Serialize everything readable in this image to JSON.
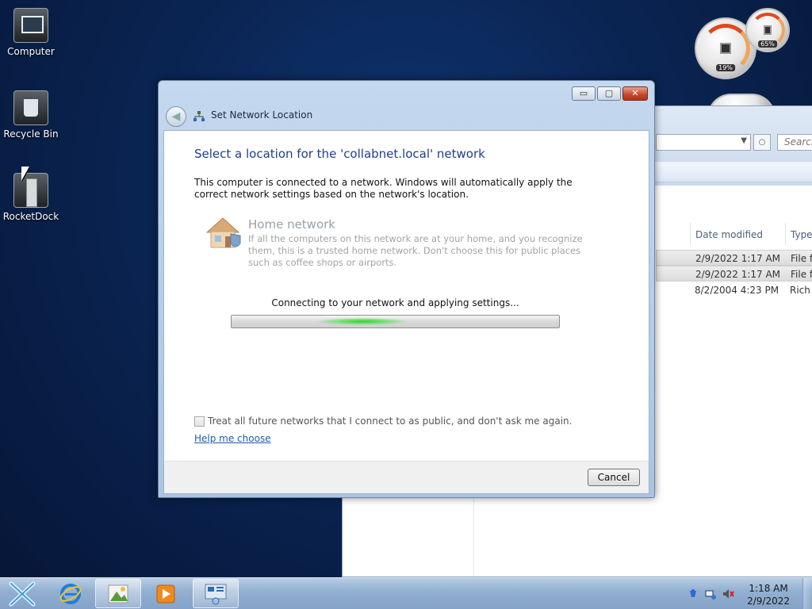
{
  "desktop": {
    "icons": [
      {
        "label": "Computer"
      },
      {
        "label": "Recycle Bin"
      },
      {
        "label": "RocketDock"
      }
    ]
  },
  "gadgets": {
    "cpu_percent": "19%",
    "memory_percent": "65%"
  },
  "explorer": {
    "search_placeholder": "Search",
    "columns": {
      "date": "Date modified",
      "type": "Type"
    },
    "rows": [
      {
        "date": "2/9/2022 1:17 AM",
        "type": "File fo",
        "selected": true
      },
      {
        "date": "2/9/2022 1:17 AM",
        "type": "File fo",
        "selected": true
      },
      {
        "date": "8/2/2004 4:23 PM",
        "type": "Rich T",
        "selected": false
      }
    ]
  },
  "dialog": {
    "title": "Set Network Location",
    "heading": "Select a location for the 'collabnet.local' network",
    "intro": "This computer is connected to a network. Windows will automatically apply the correct network settings based on the network's location.",
    "option": {
      "title": "Home network",
      "description": "If all the computers on this network are at your home, and you recognize them, this is a trusted home network.  Don't choose this for public places such as coffee shops or airports."
    },
    "status": "Connecting to your network and applying settings...",
    "progress_state": "indeterminate",
    "checkbox_label": "Treat all future networks that I connect to as public, and don't ask me again.",
    "checkbox_checked": false,
    "help_link": "Help me choose",
    "cancel_label": "Cancel",
    "buttons": {
      "minimize": "▭",
      "maximize": "▢",
      "close": "✕"
    }
  },
  "taskbar": {
    "clock_time": "1:18 AM",
    "clock_date": "2/9/2022",
    "items": [
      "start-x-icon",
      "internet-explorer-icon",
      "image-viewer-icon",
      "media-player-icon",
      "network-settings-icon"
    ]
  },
  "colors": {
    "heading": "#1e3e8a",
    "link": "#1a5ea8",
    "progress_glow": "#2ed12e",
    "close_button": "#c7452b"
  }
}
